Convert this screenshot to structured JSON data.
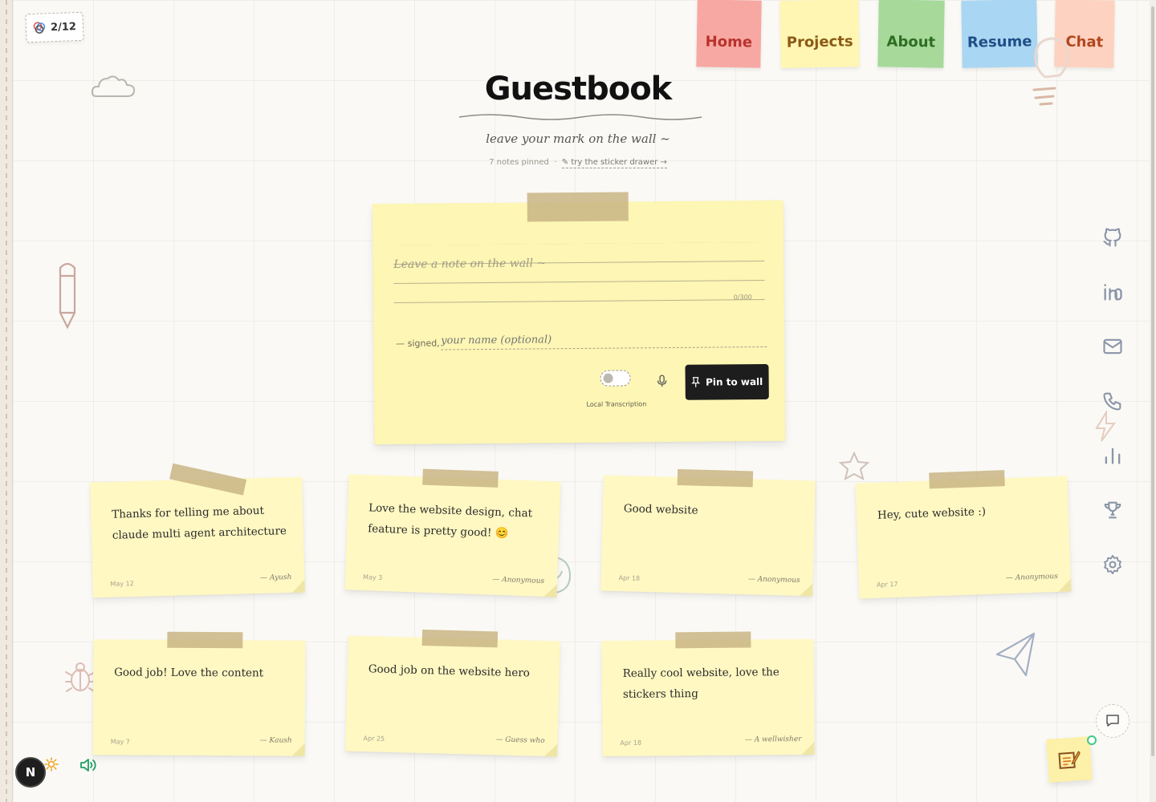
{
  "counter": {
    "label": "2/12"
  },
  "nav": {
    "tabs": [
      {
        "label": "Home",
        "bg": "#f8a8a3",
        "color": "#b8322c"
      },
      {
        "label": "Projects",
        "bg": "#fff6b3",
        "color": "#8a5a16"
      },
      {
        "label": "About",
        "bg": "#a6d99a",
        "color": "#2f6d22"
      },
      {
        "label": "Resume",
        "bg": "#a9d6f3",
        "color": "#1f4f86"
      },
      {
        "label": "Chat",
        "bg": "#fdd2c0",
        "color": "#b2461e"
      }
    ]
  },
  "header": {
    "title": "Guestbook",
    "subtitle": "leave your mark on the wall ~",
    "notes_pinned": "7 notes pinned",
    "separator": "·",
    "sticker_link": "try the sticker drawer →"
  },
  "compose": {
    "placeholder": "Leave a note on the wall ~",
    "char_count": "0/300",
    "signed_label": "— signed,",
    "name_placeholder": "your name (optional)",
    "toggle_label": "Local Transcription",
    "pin_button": "Pin to wall"
  },
  "notes": [
    {
      "message": "Thanks for telling me about claude multi agent architecture",
      "date": "May 12",
      "author": "— Ayush"
    },
    {
      "message": "Love the website design, chat feature is pretty good! 😊",
      "date": "May 3",
      "author": "— Anonymous"
    },
    {
      "message": "Good website",
      "date": "Apr 18",
      "author": "— Anonymous"
    },
    {
      "message": "Hey, cute website :)",
      "date": "Apr 17",
      "author": "— Anonymous"
    },
    {
      "message": "Good job! Love the content",
      "date": "May 7",
      "author": "— Kaush"
    },
    {
      "message": "Good job on the website hero",
      "date": "Apr 25",
      "author": "— Guess who"
    },
    {
      "message": "Really cool website, love the stickers thing",
      "date": "Apr 18",
      "author": "— A wellwisher"
    }
  ],
  "bottom": {
    "avatar_letter": "N"
  },
  "icons": {
    "counter": "sticker-icon",
    "rail": [
      "github-icon",
      "linkedin-icon",
      "mail-icon",
      "phone-icon",
      "chart-icon",
      "trophy-icon",
      "settings-icon"
    ],
    "bottom": [
      "sun-icon",
      "volume-icon",
      "chat-icon",
      "note-edit-icon"
    ]
  },
  "colors": {
    "note_yellow": "#fff8c2",
    "compose_yellow": "#fdf6b4",
    "tape": "#c9b584",
    "accent_dark": "#1d1d1d"
  }
}
